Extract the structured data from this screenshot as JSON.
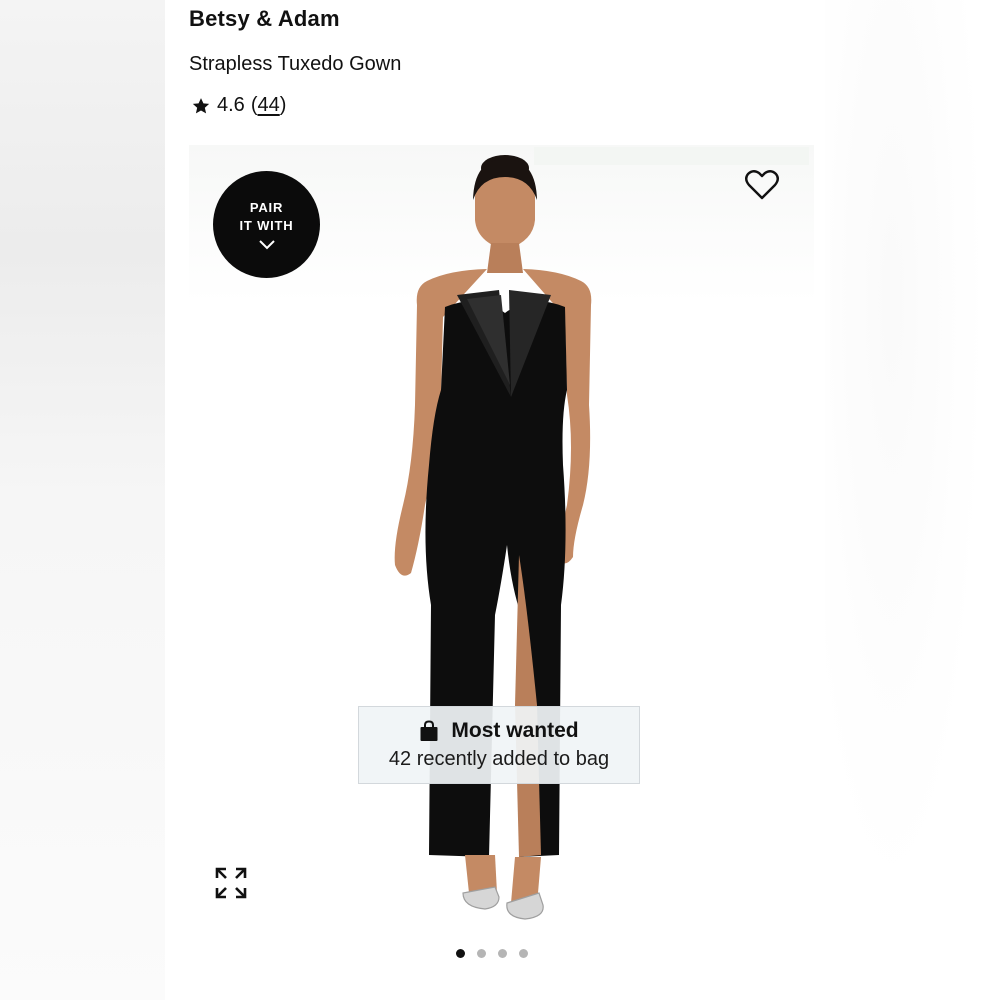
{
  "product": {
    "brand": "Betsy & Adam",
    "name": "Strapless Tuxedo Gown",
    "rating": "4.6",
    "review_count": "44"
  },
  "pair_badge": {
    "line1": "PAIR",
    "line2": "IT WITH",
    "icon": "chevron-down-icon"
  },
  "favorite": {
    "icon": "heart-icon"
  },
  "most_wanted": {
    "icon": "shopping-bag-icon",
    "title": "Most wanted",
    "subtitle": "42 recently added to bag"
  },
  "gallery": {
    "expand_icon": "expand-arrows-icon",
    "slide_count": 4,
    "active_slide": 1
  },
  "colors": {
    "text": "#111111",
    "badge_bg": "#0b0b0b",
    "banner_bg": "#f0f4f6",
    "dot_inactive": "#b5b5b5",
    "dot_active": "#111111",
    "dress": "#0d0d0d",
    "skin": "#c48a64"
  }
}
